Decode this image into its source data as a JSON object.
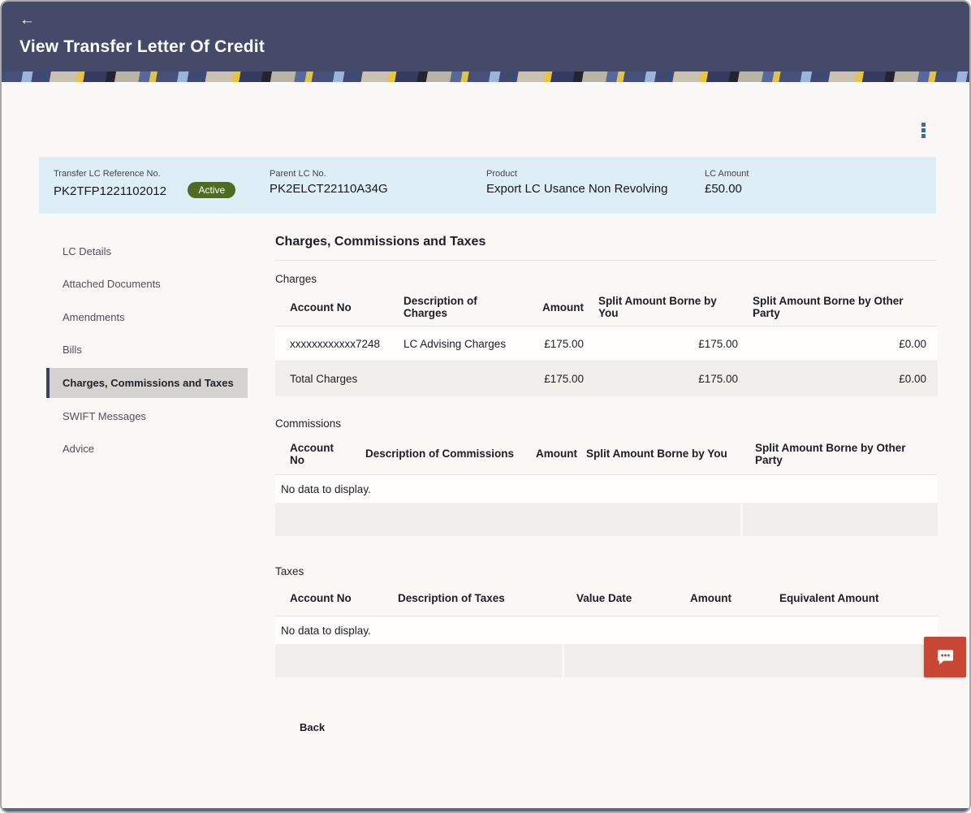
{
  "colors": {
    "header-bg": "#444a68",
    "page-bg": "#f9f8f6",
    "summary-bg": "#ddeef6",
    "badge-bg": "#4e6b22",
    "accent-red": "#c74634",
    "active-tab-bg": "#d5d3d0",
    "active-tab-border": "#3b4361",
    "kebab-blue": "#3a6fa6"
  },
  "header": {
    "back_icon": "←",
    "title": "View Transfer Letter Of Credit"
  },
  "summary": {
    "fields": [
      {
        "label": "Transfer LC Reference No.",
        "value": "PK2TFP1221102012",
        "badge": "Active"
      },
      {
        "label": "Parent LC No.",
        "value": "PK2ELCT22110A34G"
      },
      {
        "label": "Product",
        "value": "Export LC Usance Non Revolving"
      },
      {
        "label": "LC Amount",
        "value": "£50.00"
      }
    ]
  },
  "sidebar": {
    "items": [
      {
        "label": "LC Details",
        "active": false
      },
      {
        "label": "Attached Documents",
        "active": false
      },
      {
        "label": "Amendments",
        "active": false
      },
      {
        "label": "Bills",
        "active": false
      },
      {
        "label": "Charges, Commissions and Taxes",
        "active": true
      },
      {
        "label": "SWIFT Messages",
        "active": false
      },
      {
        "label": "Advice",
        "active": false
      }
    ]
  },
  "main": {
    "title": "Charges, Commissions and Taxes",
    "charges": {
      "section_label": "Charges",
      "headers": [
        "Account No",
        "Description of Charges",
        "Amount",
        "Split Amount Borne by You",
        "Split Amount Borne by Other Party"
      ],
      "rows": [
        [
          "xxxxxxxxxxxx7248",
          "LC Advising Charges",
          "£175.00",
          "£175.00",
          "£0.00"
        ]
      ],
      "total": [
        "Total Charges",
        "£175.00",
        "£175.00",
        "£0.00"
      ]
    },
    "commissions": {
      "section_label": "Commissions",
      "headers": [
        "Account No",
        "Description of Commissions",
        "Amount",
        "Split Amount Borne by You",
        "Split Amount Borne by Other Party"
      ],
      "empty_text": "No data to display."
    },
    "taxes": {
      "section_label": "Taxes",
      "headers": [
        "Account No",
        "Description of Taxes",
        "Value Date",
        "Amount",
        "Equivalent Amount"
      ],
      "empty_text": "No data to display."
    },
    "back_label": "Back"
  }
}
